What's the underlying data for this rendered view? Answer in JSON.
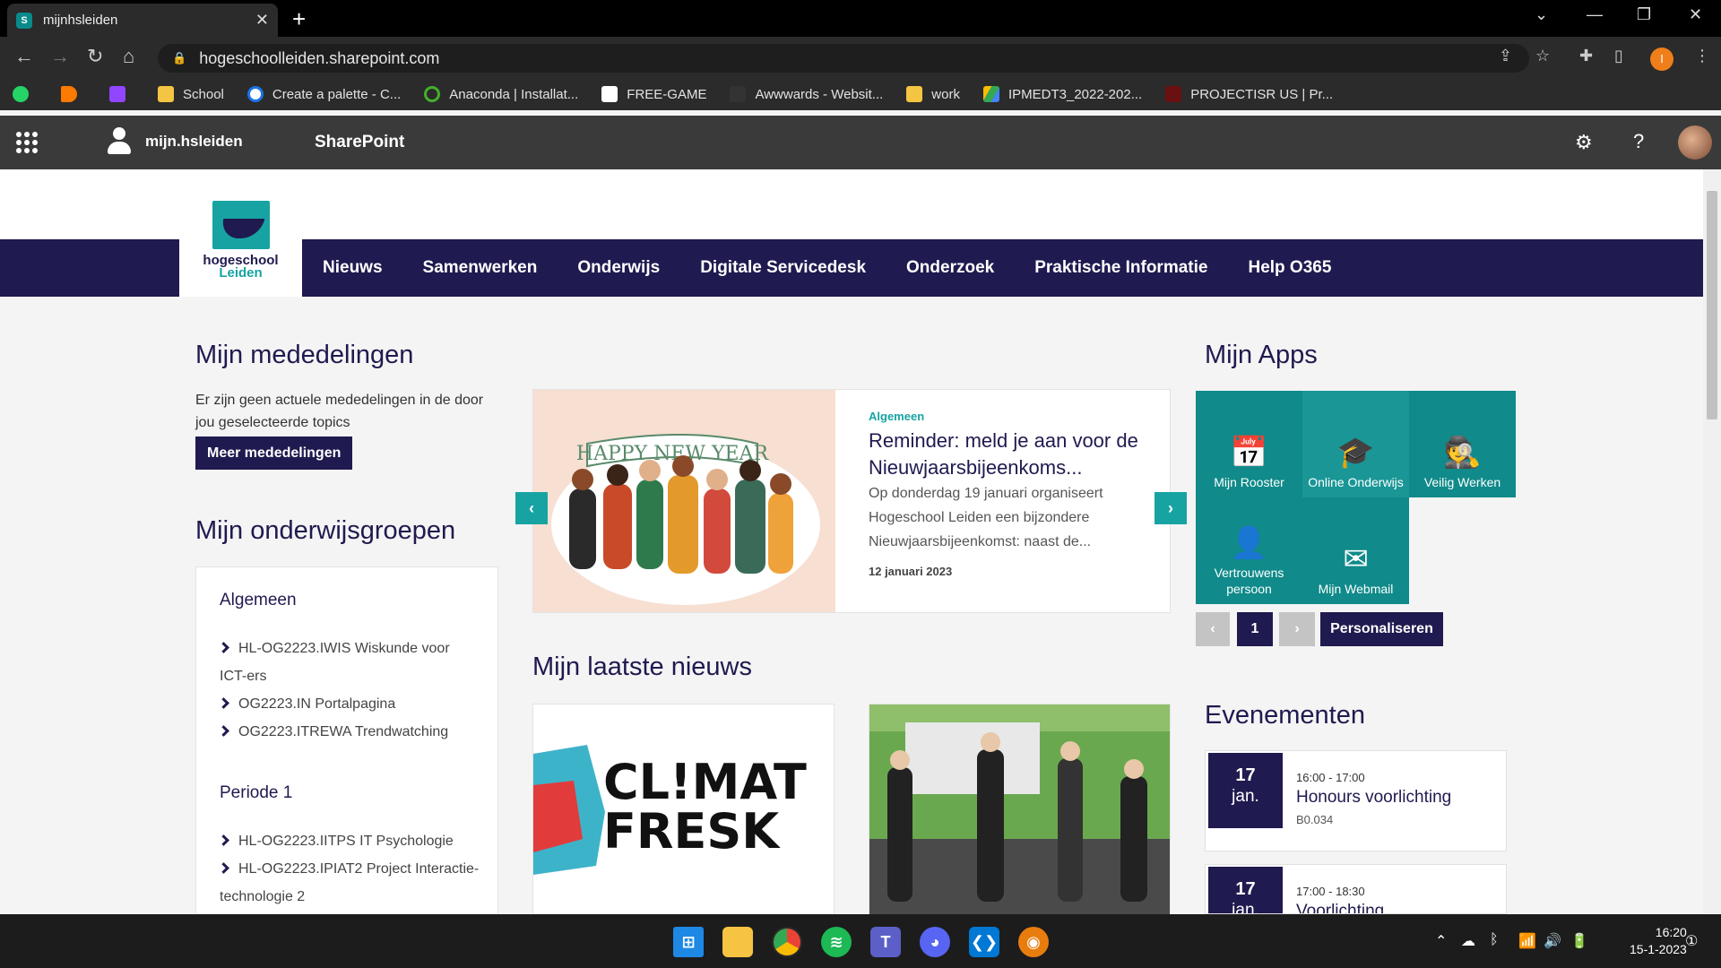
{
  "browser": {
    "tab_title": "mijnhsleiden",
    "url": "hogeschoolleiden.sharepoint.com",
    "profile_initial": "I",
    "bookmarks": [
      "School",
      "Create a palette - C...",
      "Anaconda | Installat...",
      "FREE-GAME",
      "Awwwards - Websit...",
      "work",
      "IPMEDT3_2022-202...",
      "PROJECTISR US | Pr..."
    ]
  },
  "suitebar": {
    "user_label": "mijn.hsleiden",
    "app_name": "SharePoint"
  },
  "logo": {
    "line1": "hogeschool",
    "line2": "Leiden"
  },
  "topnav": [
    "Nieuws",
    "Samenwerken",
    "Onderwijs",
    "Digitale Servicedesk",
    "Onderzoek",
    "Praktische Informatie",
    "Help O365"
  ],
  "mededelingen": {
    "title": "Mijn mededelingen",
    "text": "Er zijn geen actuele mededelingen in de door jou geselecteerde topics",
    "button": "Meer mededelingen"
  },
  "onderwijsgroepen": {
    "title": "Mijn onderwijsgroepen",
    "groups": [
      {
        "heading": "Algemeen",
        "items": [
          "HL-OG2223.IWIS Wiskunde voor ICT-ers",
          "OG2223.IN Portalpagina",
          "OG2223.ITREWA Trendwatching"
        ]
      },
      {
        "heading": "Periode 1",
        "items": [
          "HL-OG2223.IITPS IT Psychologie",
          "HL-OG2223.IPIAT2 Project Interactie-technologie 2"
        ]
      }
    ]
  },
  "carousel": {
    "image_text": "HAPPY NEW YEAR",
    "category": "Algemeen",
    "title": "Reminder: meld je aan voor de Nieuwjaarsbijeenkoms...",
    "body": "Op donderdag 19 januari organiseert Hogeschool Leiden een bijzondere Nieuwjaarsbijeenkomst: naast de...",
    "date": "12 januari 2023"
  },
  "nieuws": {
    "title": "Mijn laatste nieuws",
    "card1_logo": [
      "CL!MAT",
      "FRESK"
    ]
  },
  "apps": {
    "title": "Mijn Apps",
    "items": [
      {
        "label": "Mijn Rooster",
        "icon": "calendar-icon"
      },
      {
        "label": "Online Onderwijs",
        "icon": "graduation-cap-icon"
      },
      {
        "label": "Veilig Werken",
        "icon": "spy-icon"
      },
      {
        "label": "Vertrouwens persoon",
        "icon": "user-shield-icon"
      },
      {
        "label": "Mijn Webmail",
        "icon": "mail-icon"
      }
    ],
    "page": "1",
    "personalize": "Personaliseren"
  },
  "evenementen": {
    "title": "Evenementen",
    "items": [
      {
        "day": "17",
        "month": "jan.",
        "time": "16:00 - 17:00",
        "title": "Honours voorlichting",
        "location": "B0.034"
      },
      {
        "day": "17",
        "month": "jan.",
        "time": "17:00 - 18:30",
        "title": "Voorlichting",
        "location": ""
      }
    ]
  },
  "taskbar": {
    "time": "16:20",
    "date": "15-1-2023"
  },
  "colors": {
    "navy": "#1f1a4f",
    "teal": "#18a3a3",
    "app_teal": "#108a8a"
  }
}
